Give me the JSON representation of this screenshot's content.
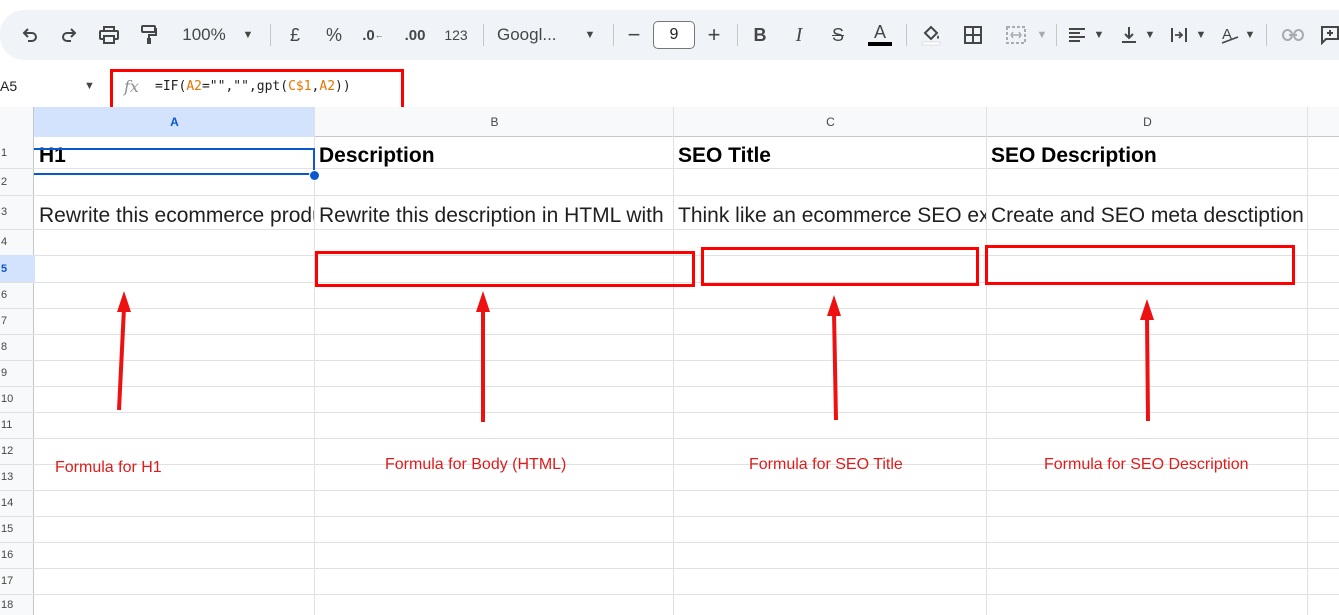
{
  "toolbar": {
    "zoom": "100%",
    "currency_label": "£",
    "percent_label": "%",
    "decrease_decimal_label": ".0",
    "increase_decimal_label": ".00",
    "number_format_label": "123",
    "font_family": "Googl...",
    "font_size": "9",
    "minus_label": "−",
    "plus_label": "+",
    "bold_label": "B",
    "italic_label": "I",
    "strike_label": "S",
    "text_color_label": "A"
  },
  "formula_bar": {
    "cell_ref": "A5",
    "fx_label": "fx",
    "formula_parts": [
      "=IF(",
      "A2",
      "=\"\",\"\",gpt(",
      "C$1",
      ",",
      "A2",
      "))"
    ]
  },
  "columns": [
    "A",
    "B",
    "C",
    "D"
  ],
  "rows": [
    "1",
    "2",
    "3",
    "4",
    "5",
    "6",
    "7",
    "8",
    "9",
    "10",
    "11",
    "12",
    "13",
    "14",
    "15",
    "16",
    "17",
    "18"
  ],
  "cells": {
    "A1": "H1",
    "B1": "Description",
    "C1": "SEO Title",
    "D1": "SEO Description",
    "A3": "Rewrite this ecommerce product title",
    "B3": "Rewrite this description in HTML with",
    "C3": "Think like an ecommerce SEO expert",
    "D3": "Create and SEO meta desctiption"
  },
  "annotations": {
    "h1": "Formula for H1",
    "body": "Formula for Body (HTML)",
    "seo_title": "Formula for SEO Title",
    "seo_description": "Formula for SEO Description"
  },
  "colors": {
    "annotation_red": "#ff0000",
    "selection_blue": "#0b57d0"
  }
}
